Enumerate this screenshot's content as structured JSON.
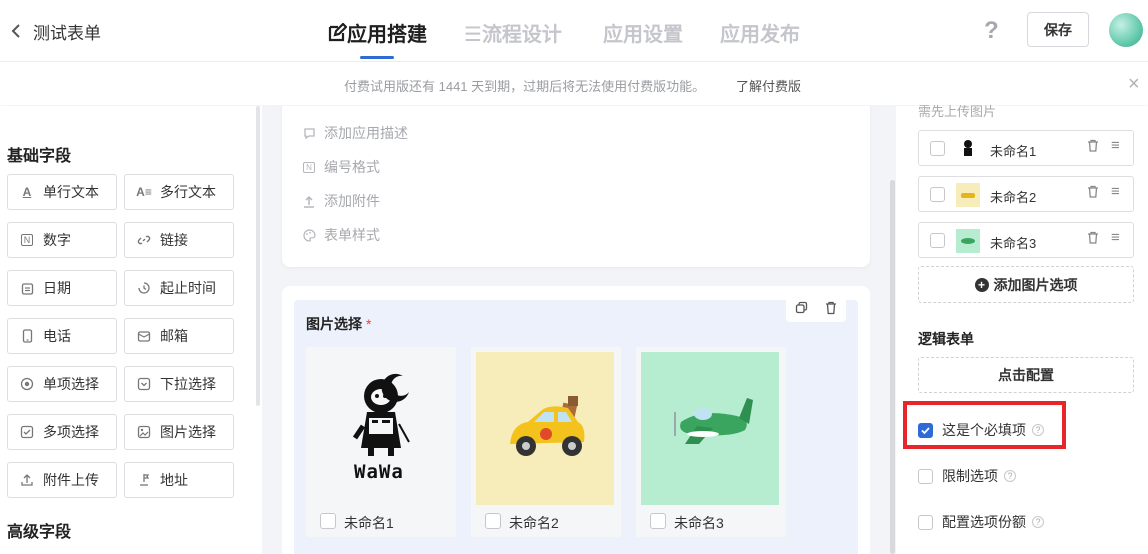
{
  "header": {
    "title": "测试表单",
    "tabs": [
      {
        "label": "应用搭建",
        "active": true
      },
      {
        "label": "流程设计",
        "active": false
      },
      {
        "label": "应用设置",
        "active": false
      },
      {
        "label": "应用发布",
        "active": false
      }
    ],
    "help_label": "?",
    "save_label": "保存"
  },
  "notice": {
    "text": "付费试用版还有 1441 天到期，过期后将无法使用付费版功能。",
    "link": "了解付费版",
    "close": "×"
  },
  "left_panel": {
    "basic_group_title": "基础字段",
    "advanced_group_title": "高级字段",
    "fields": [
      {
        "label": "单行文本",
        "icon": "text-a-icon"
      },
      {
        "label": "多行文本",
        "icon": "multiline-text-icon"
      },
      {
        "label": "数字",
        "icon": "number-icon"
      },
      {
        "label": "链接",
        "icon": "link-icon"
      },
      {
        "label": "日期",
        "icon": "calendar-icon"
      },
      {
        "label": "起止时间",
        "icon": "clock-range-icon"
      },
      {
        "label": "电话",
        "icon": "phone-icon"
      },
      {
        "label": "邮箱",
        "icon": "mail-icon"
      },
      {
        "label": "单项选择",
        "icon": "radio-icon"
      },
      {
        "label": "下拉选择",
        "icon": "dropdown-icon"
      },
      {
        "label": "多项选择",
        "icon": "checkbox-icon"
      },
      {
        "label": "图片选择",
        "icon": "image-icon"
      },
      {
        "label": "附件上传",
        "icon": "upload-icon"
      },
      {
        "label": "地址",
        "icon": "location-icon"
      }
    ]
  },
  "canvas": {
    "menu": [
      {
        "label": "添加应用描述",
        "icon": "comment-icon"
      },
      {
        "label": "编号格式",
        "icon": "number-format-icon"
      },
      {
        "label": "添加附件",
        "icon": "attachment-upload-icon"
      },
      {
        "label": "表单样式",
        "icon": "palette-icon"
      }
    ],
    "field": {
      "title": "图片选择",
      "required": "*",
      "options": [
        {
          "label": "未命名1",
          "image": "astronaut-logo",
          "caption": "WaWa"
        },
        {
          "label": "未命名2",
          "image": "yellow-car"
        },
        {
          "label": "未命名3",
          "image": "green-airplane"
        }
      ]
    }
  },
  "right_panel": {
    "hint": "需先上传图片",
    "options": [
      {
        "label": "未命名1",
        "thumb_color": "#ffffff"
      },
      {
        "label": "未命名2",
        "thumb_color": "#f7edba"
      },
      {
        "label": "未命名3",
        "thumb_color": "#b6ecd0"
      }
    ],
    "add_option": "添加图片选项",
    "logic_title": "逻辑表单",
    "config_button": "点击配置",
    "checks": [
      {
        "label": "这是个必填项",
        "checked": true
      },
      {
        "label": "限制选项",
        "checked": false
      },
      {
        "label": "配置选项份额",
        "checked": false
      }
    ]
  },
  "colors": {
    "accent": "#2f6bd6",
    "highlight": "#e8252b",
    "canvas_bg": "#f3f4f7",
    "selected_field_bg": "#edf1fc"
  }
}
